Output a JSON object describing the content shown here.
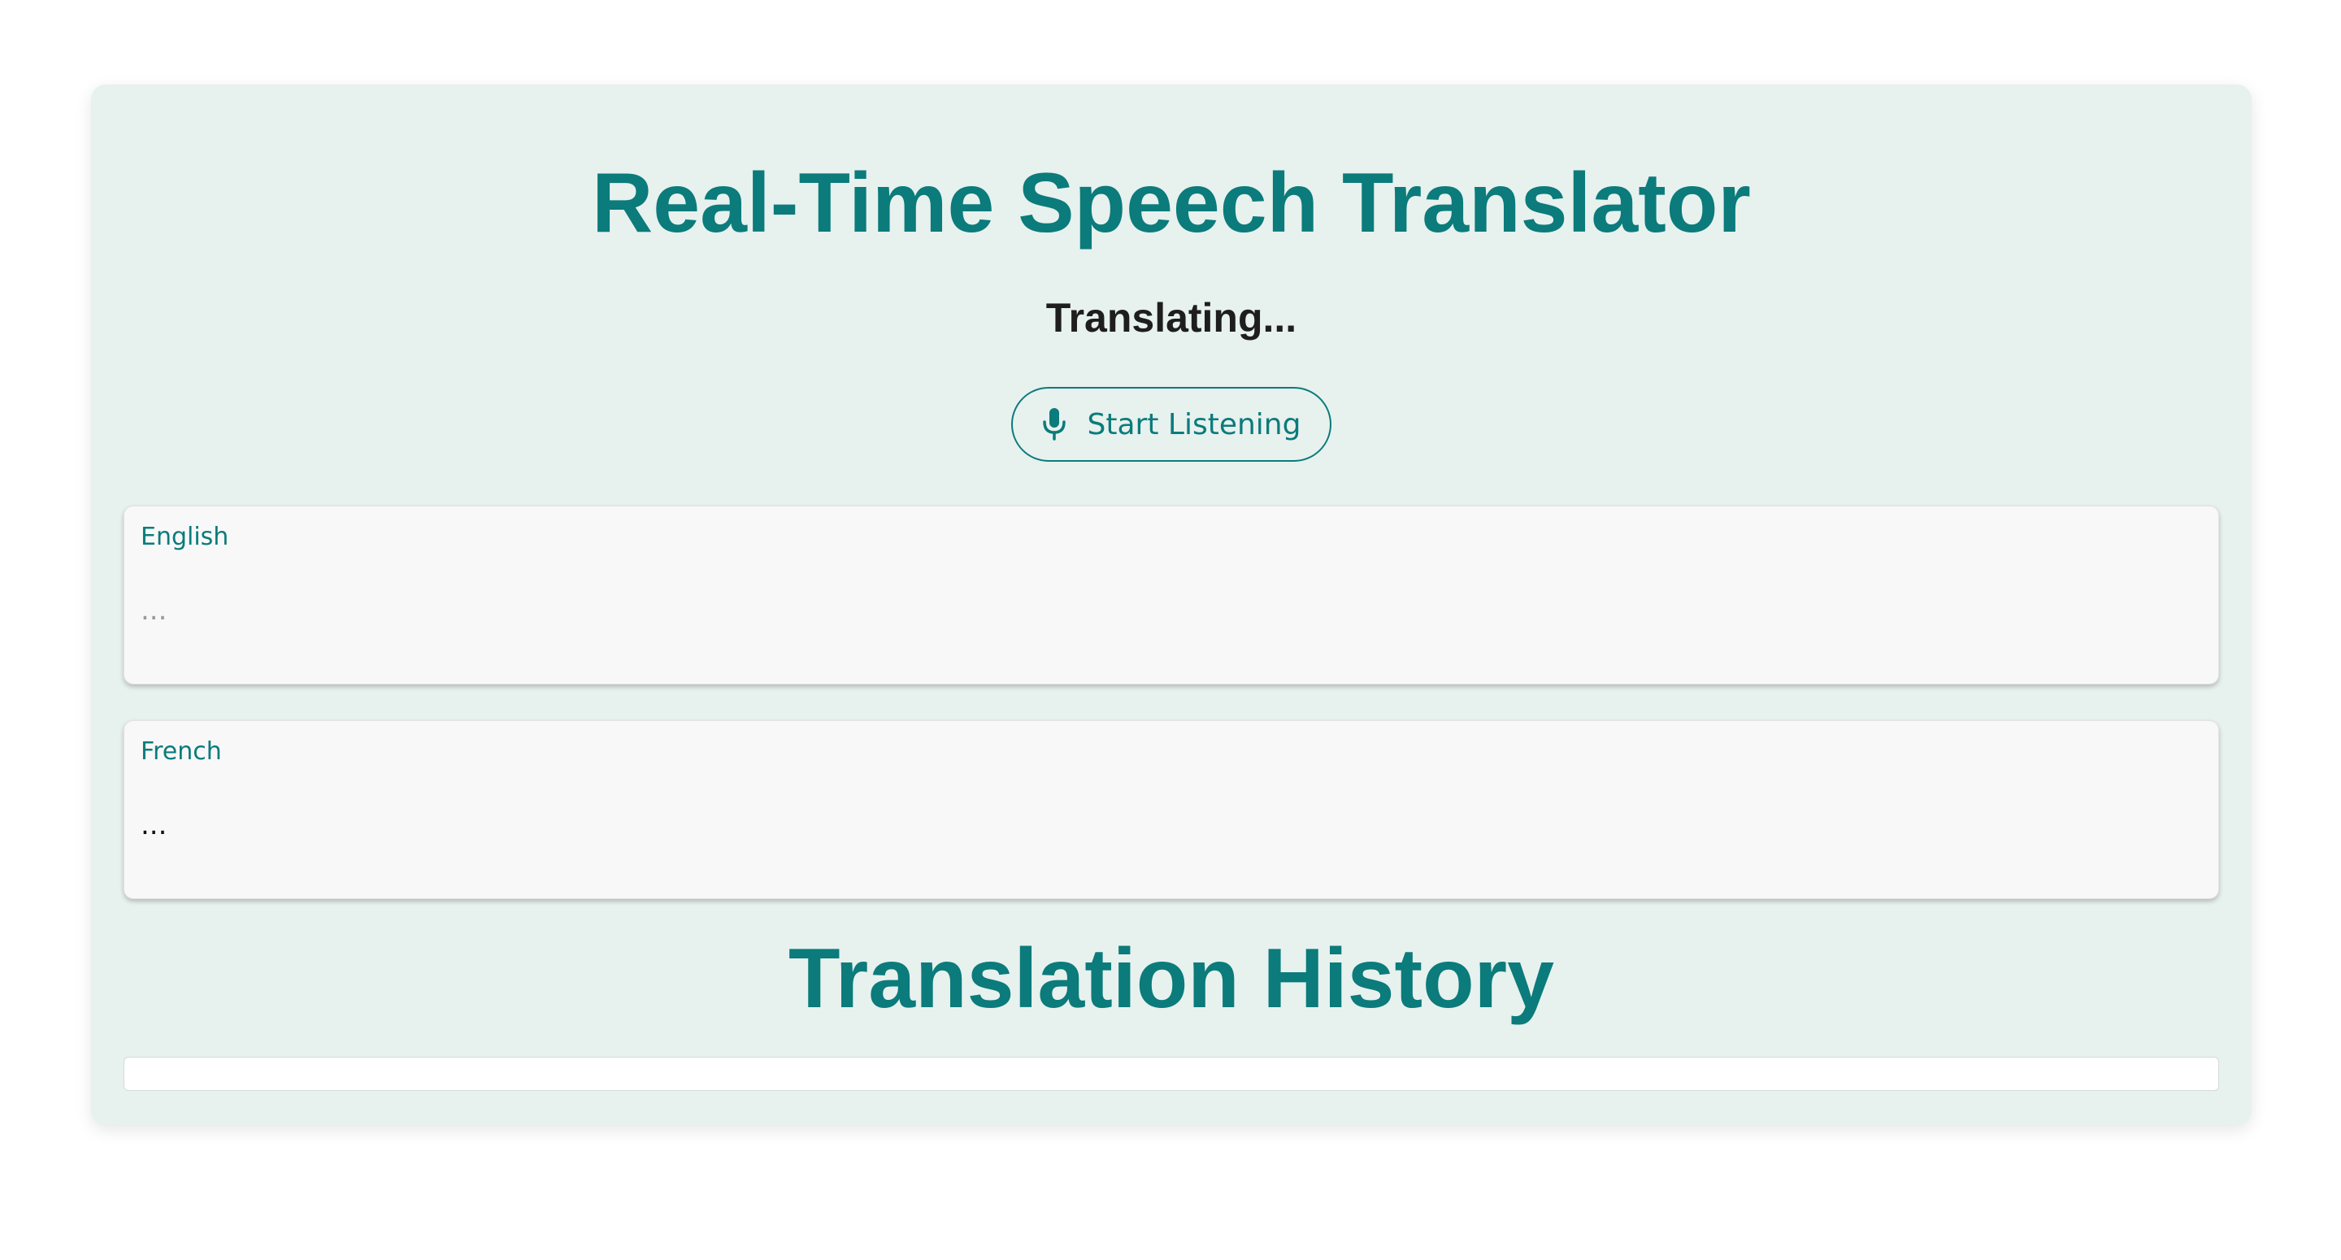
{
  "app": {
    "title": "Real-Time Speech Translator",
    "status": "Translating..."
  },
  "controls": {
    "listen_button_label": "Start Listening",
    "listen_button_icon": "microphone-icon"
  },
  "panels": {
    "source": {
      "language": "English",
      "text": "..."
    },
    "target": {
      "language": "French",
      "text": "..."
    }
  },
  "history": {
    "title": "Translation History",
    "items": []
  },
  "colors": {
    "accent": "#0b7b7b",
    "container_background": "#e7f1ee",
    "card_background": "#f8f8f8",
    "status_text": "#1e1e1e"
  }
}
